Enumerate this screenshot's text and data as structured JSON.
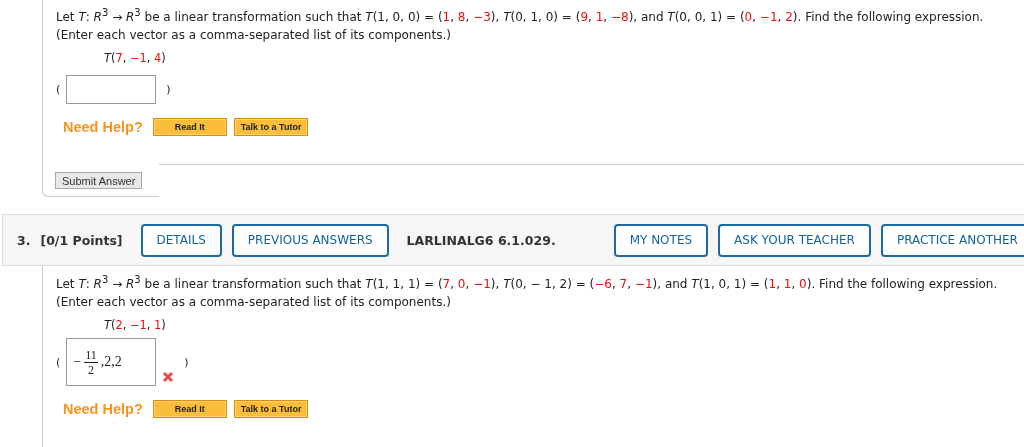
{
  "problem_2": {
    "statement": [
      {
        "t": "Let *T*: *R*$^{3}$ → *R*$^{3}$ be a linear transformation such that *T*(1, 0, 0) = (",
        "red": false
      },
      {
        "t": "1",
        "red": true
      },
      {
        "t": ", ",
        "red": false
      },
      {
        "t": "8",
        "red": true
      },
      {
        "t": ", ",
        "red": false
      },
      {
        "t": "−3",
        "red": true
      },
      {
        "t": "), *T*(0, 1, 0) = (",
        "red": false
      },
      {
        "t": "9",
        "red": true
      },
      {
        "t": ", ",
        "red": false
      },
      {
        "t": "1",
        "red": true
      },
      {
        "t": ", ",
        "red": false
      },
      {
        "t": "−8",
        "red": true
      },
      {
        "t": "), and *T*(0, 0, 1) = (",
        "red": false
      },
      {
        "t": "0",
        "red": true
      },
      {
        "t": ", ",
        "red": false
      },
      {
        "t": "−1",
        "red": true
      },
      {
        "t": ", ",
        "red": false
      },
      {
        "t": "2",
        "red": true
      },
      {
        "t": "). Find the following expression.",
        "red": false
      }
    ],
    "instruction": "(Enter each vector as a comma-separated list of its components.)",
    "expression": [
      {
        "t": "*T*(",
        "red": false
      },
      {
        "t": "7",
        "red": true
      },
      {
        "t": ", ",
        "red": false
      },
      {
        "t": "−1",
        "red": true
      },
      {
        "t": ", ",
        "red": false
      },
      {
        "t": "4",
        "red": true
      },
      {
        "t": ")",
        "red": false
      }
    ],
    "open_paren": "(",
    "close_paren": ")",
    "help_label": "Need Help?",
    "help_buttons": [
      "Read It",
      "Talk to a Tutor"
    ],
    "submit": "Submit Answer"
  },
  "problem_3": {
    "number": "3.",
    "points": "[0/1 Points]",
    "header_buttons": [
      "DETAILS",
      "PREVIOUS ANSWERS"
    ],
    "code": "LARLINALG6 6.1.029.",
    "header_buttons_right": [
      "MY NOTES",
      "ASK YOUR TEACHER",
      "PRACTICE ANOTHER"
    ],
    "statement": [
      {
        "t": "Let *T*: *R*$^{3}$ → *R*$^{3}$ be a linear transformation such that *T*(1, 1, 1) = (",
        "red": false
      },
      {
        "t": "7",
        "red": true
      },
      {
        "t": ", ",
        "red": false
      },
      {
        "t": "0",
        "red": true
      },
      {
        "t": ", ",
        "red": false
      },
      {
        "t": "−1",
        "red": true
      },
      {
        "t": "), *T*(0, − 1, 2) = (",
        "red": false
      },
      {
        "t": "−6",
        "red": true
      },
      {
        "t": ", ",
        "red": false
      },
      {
        "t": "7",
        "red": true
      },
      {
        "t": ", ",
        "red": false
      },
      {
        "t": "−1",
        "red": true
      },
      {
        "t": "), and *T*(1, 0, 1) = (",
        "red": false
      },
      {
        "t": "1",
        "red": true
      },
      {
        "t": ", ",
        "red": false
      },
      {
        "t": "1",
        "red": true
      },
      {
        "t": ", ",
        "red": false
      },
      {
        "t": "0",
        "red": true
      },
      {
        "t": "). Find the following expression.",
        "red": false
      }
    ],
    "instruction": "(Enter each vector as a comma-separated list of its components.)",
    "expression": [
      {
        "t": "*T*(",
        "red": false
      },
      {
        "t": "2",
        "red": true
      },
      {
        "t": ", ",
        "red": false
      },
      {
        "t": "−1",
        "red": true
      },
      {
        "t": ", ",
        "red": false
      },
      {
        "t": "1",
        "red": true
      },
      {
        "t": ")",
        "red": false
      }
    ],
    "open_paren": "(",
    "close_paren": ")",
    "answer": {
      "sign": "−",
      "numerator": "11",
      "denominator": "2",
      "rest": ",2,2"
    },
    "incorrect": true,
    "help_label": "Need Help?",
    "help_buttons": [
      "Read It",
      "Talk to a Tutor"
    ]
  }
}
